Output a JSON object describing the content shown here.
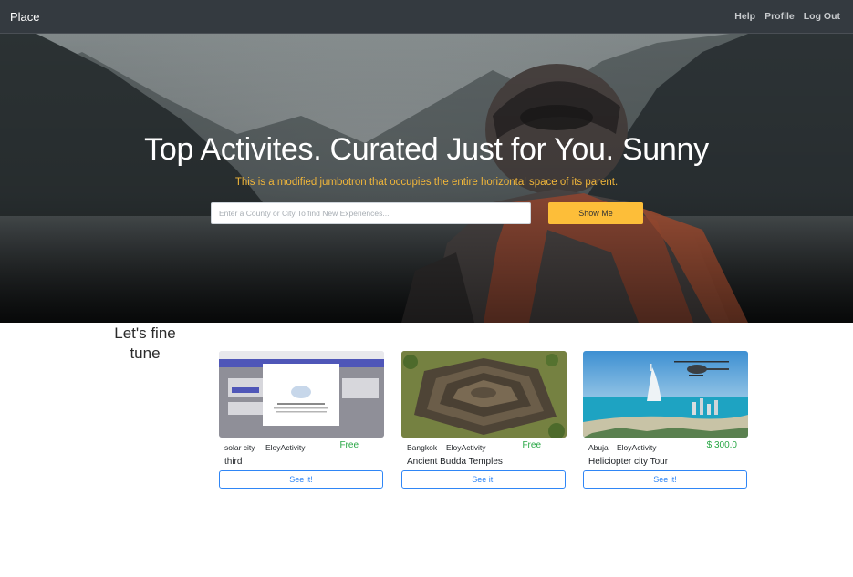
{
  "navbar": {
    "brand": "Place",
    "links": [
      "Help",
      "Profile",
      "Log Out"
    ]
  },
  "hero": {
    "title": "Top Activites. Curated Just for You. Sunny",
    "subtitle": "This is a modified jumbotron that occupies the entire horizontal space of its parent.",
    "search_placeholder": "Enter a County or City To find New Experiences...",
    "search_value": "",
    "button_label": "Show Me"
  },
  "side": {
    "heading": "Let's fine tune"
  },
  "cards": [
    {
      "city": "solar city",
      "host": "EloyActivity",
      "price": "Free",
      "title": "third",
      "button": "See it!",
      "image": "browser-screenshot-thumbnail"
    },
    {
      "city": "Bangkok",
      "host": "EloyActivity",
      "price": "Free",
      "title": "Ancient Budda Temples",
      "button": "See it!",
      "image": "temple-aerial-photo"
    },
    {
      "city": "Abuja",
      "host": "EloyActivity",
      "price": "$ 300.0",
      "title": "Heliciopter city Tour",
      "button": "See it!",
      "image": "helicopter-coast-photo"
    }
  ],
  "colors": {
    "navbar": "#343a40",
    "accent_yellow": "#fdbe39",
    "subtitle_gold": "#f0b63a",
    "price_green": "#28a745",
    "button_blue": "#2f86f6"
  }
}
